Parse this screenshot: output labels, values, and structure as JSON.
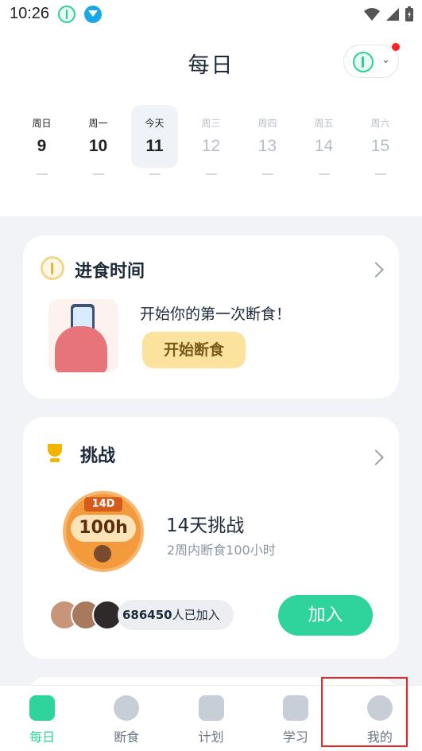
{
  "status_bar": {
    "time": "10:26"
  },
  "header": {
    "title": "每日",
    "days": [
      {
        "name": "周日",
        "num": "9",
        "state": "past"
      },
      {
        "name": "周一",
        "num": "10",
        "state": "past"
      },
      {
        "name": "今天",
        "num": "11",
        "state": "today"
      },
      {
        "name": "周三",
        "num": "12",
        "state": "future"
      },
      {
        "name": "周四",
        "num": "13",
        "state": "future"
      },
      {
        "name": "周五",
        "num": "14",
        "state": "future"
      },
      {
        "name": "周六",
        "num": "15",
        "state": "future"
      }
    ]
  },
  "eating_card": {
    "title": "进食时间",
    "prompt": "开始你的第一次断食！",
    "button": "开始断食"
  },
  "challenge_card": {
    "title": "挑战",
    "badge_tag": "14D",
    "badge_hours": "100h",
    "name": "14天挑战",
    "subtitle": "2周内断食100小时",
    "join_count": "686450",
    "join_suffix": "人已加入",
    "join_button": "加入"
  },
  "tabs": [
    {
      "label": "每日",
      "active": true,
      "icon": "daily-icon"
    },
    {
      "label": "断食",
      "active": false,
      "icon": "lightning-icon"
    },
    {
      "label": "计划",
      "active": false,
      "icon": "plan-icon"
    },
    {
      "label": "学习",
      "active": false,
      "icon": "book-icon"
    },
    {
      "label": "我的",
      "active": false,
      "icon": "profile-icon"
    }
  ],
  "colors": {
    "accent": "#2fd39c",
    "highlight": "#e22222",
    "badge": "#f39a3d"
  }
}
